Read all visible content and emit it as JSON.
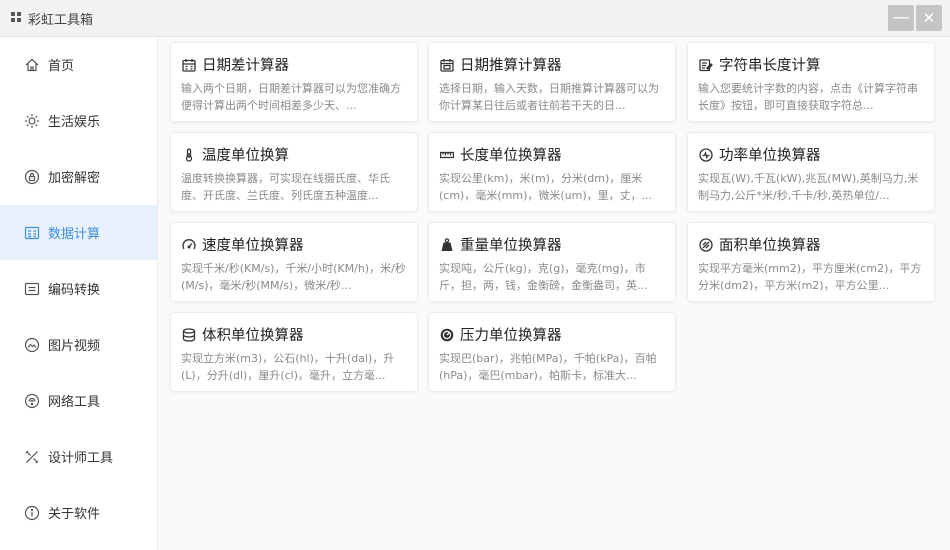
{
  "window": {
    "title": "彩虹工具箱",
    "minimize_label": "—",
    "close_label": "✕"
  },
  "sidebar": {
    "items": [
      {
        "label": "首页",
        "icon": "home-icon"
      },
      {
        "label": "生活娱乐",
        "icon": "sun-icon"
      },
      {
        "label": "加密解密",
        "icon": "lock-icon"
      },
      {
        "label": "数据计算",
        "icon": "calculator-icon",
        "active": true
      },
      {
        "label": "编码转换",
        "icon": "code-icon"
      },
      {
        "label": "图片视频",
        "icon": "image-icon"
      },
      {
        "label": "网络工具",
        "icon": "network-icon"
      },
      {
        "label": "设计师工具",
        "icon": "design-tools-icon"
      },
      {
        "label": "关于软件",
        "icon": "info-icon"
      }
    ]
  },
  "cards": [
    {
      "title": "日期差计算器",
      "icon": "calendar-icon",
      "desc": "输入两个日期，日期差计算器可以为您准确方便得计算出两个时间相差多少天、..."
    },
    {
      "title": "日期推算计算器",
      "icon": "calendar-check-icon",
      "desc": "选择日期，输入天数，日期推算计算器可以为你计算某日往后或者往前若干天的日..."
    },
    {
      "title": "字符串长度计算",
      "icon": "text-edit-icon",
      "desc": "输入您要统计字数的内容，点击《计算字符串长度》按钮，即可直接获取字符总..."
    },
    {
      "title": "温度单位换算",
      "icon": "thermometer-icon",
      "desc": "温度转换换算器，可实现在线摄氏度、华氏度、开氏度、兰氏度、列氏度五种温度..."
    },
    {
      "title": "长度单位换算器",
      "icon": "ruler-icon",
      "desc": "实现公里(km)，米(m)，分米(dm)，厘米(cm)，毫米(mm)，微米(um)，里，丈，..."
    },
    {
      "title": "功率单位换算器",
      "icon": "power-meter-icon",
      "desc": "实现瓦(W),千瓦(kW),兆瓦(MW),英制马力,米制马力,公斤*米/秒,千卡/秒,英热单位/..."
    },
    {
      "title": "速度单位换算器",
      "icon": "speedometer-icon",
      "desc": "实现千米/秒(KM/s)，千米/小时(KM/h)，米/秒(M/s)，毫米/秒(MM/s)，微米/秒..."
    },
    {
      "title": "重量单位换算器",
      "icon": "weight-icon",
      "desc": "实现吨，公斤(kg)，克(g)，毫克(mg)，市斤，担，两，钱，金衡磅，金衡盎司，英..."
    },
    {
      "title": "面积单位换算器",
      "icon": "area-icon",
      "desc": "实现平方毫米(mm2)，平方厘米(cm2)，平方分米(dm2)，平方米(m2)，平方公里..."
    },
    {
      "title": "体积单位换算器",
      "icon": "database-icon",
      "desc": "实现立方米(m3)，公石(hl)，十升(dal)，升(L)，分升(dl)，厘升(cl)，毫升，立方毫..."
    },
    {
      "title": "压力单位换算器",
      "icon": "gauge-icon",
      "desc": "实现巴(bar)，兆帕(MPa)，千帕(kPa)，百帕(hPa)，毫巴(mbar)，帕斯卡，标准大..."
    }
  ],
  "colors": {
    "accent": "#3d8fd6",
    "active_bg": "#e8f1fb",
    "titlebar_bg": "#f2f2f2",
    "window_button_bg": "#c4c4c4"
  }
}
